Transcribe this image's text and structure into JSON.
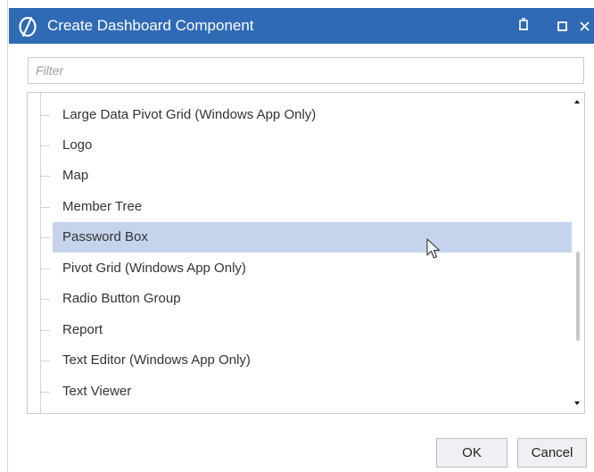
{
  "window": {
    "title": "Create Dashboard Component",
    "accent_color": "#2f6ab5"
  },
  "filter": {
    "placeholder": "Filter",
    "value": ""
  },
  "tree": {
    "items": [
      {
        "label": "Large Data Pivot Grid (Windows App Only)",
        "selected": false
      },
      {
        "label": "Logo",
        "selected": false
      },
      {
        "label": "Map",
        "selected": false
      },
      {
        "label": "Member Tree",
        "selected": false
      },
      {
        "label": "Password Box",
        "selected": true
      },
      {
        "label": "Pivot Grid (Windows App Only)",
        "selected": false
      },
      {
        "label": "Radio Button Group",
        "selected": false
      },
      {
        "label": "Report",
        "selected": false
      },
      {
        "label": "Text Editor (Windows App Only)",
        "selected": false
      },
      {
        "label": "Text Viewer",
        "selected": false
      }
    ],
    "selection_color": "#c5d4ec"
  },
  "buttons": {
    "ok_label": "OK",
    "cancel_label": "Cancel"
  },
  "icons": {
    "app": "onestream-logo-icon",
    "pin": "pin-icon",
    "maximize": "maximize-icon",
    "close": "close-icon",
    "cursor": "mouse-pointer-icon"
  }
}
